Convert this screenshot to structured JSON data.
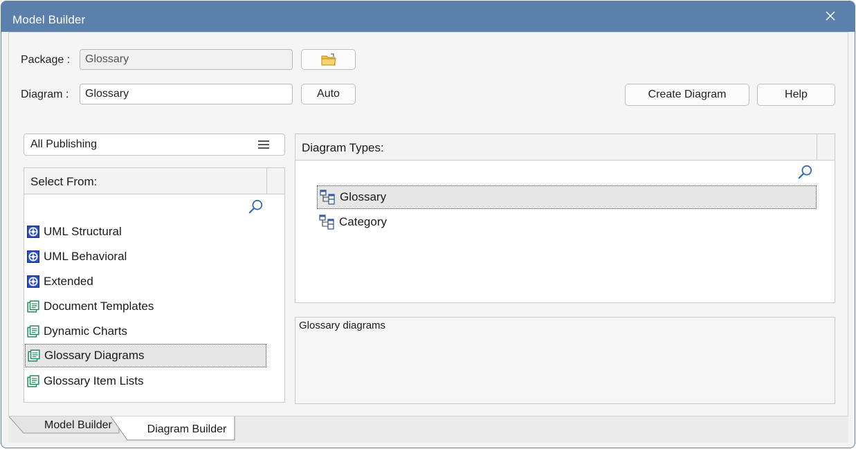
{
  "window": {
    "title": "Model Builder"
  },
  "form": {
    "package_label": "Package :",
    "package_value": "Glossary",
    "diagram_label": "Diagram :",
    "diagram_value": "Glossary",
    "auto_label": "Auto",
    "create_label": "Create Diagram",
    "help_label": "Help"
  },
  "filter": {
    "selected": "All Publishing"
  },
  "select_from": {
    "header": "Select From:",
    "items": [
      {
        "label": "UML Structural",
        "icon": "uml-icon"
      },
      {
        "label": "UML Behavioral",
        "icon": "uml-icon"
      },
      {
        "label": "Extended",
        "icon": "uml-icon"
      },
      {
        "label": "Document Templates",
        "icon": "publishing-icon"
      },
      {
        "label": "Dynamic Charts",
        "icon": "publishing-icon"
      },
      {
        "label": "Glossary Diagrams",
        "icon": "publishing-icon",
        "selected": true
      },
      {
        "label": "Glossary Item Lists",
        "icon": "publishing-icon"
      }
    ]
  },
  "diagram_types": {
    "header": "Diagram Types:",
    "items": [
      {
        "label": "Glossary",
        "icon": "diagram-type-icon",
        "selected": true
      },
      {
        "label": "Category",
        "icon": "diagram-type-icon"
      }
    ]
  },
  "description": "Glossary diagrams",
  "tabs": [
    {
      "label": "Model Builder",
      "active": false
    },
    {
      "label": "Diagram Builder",
      "active": true
    }
  ],
  "colors": {
    "titlebar": "#5a80ab",
    "uml_icon": "#2b4fd1",
    "publishing_icon": "#1c8a5a"
  }
}
